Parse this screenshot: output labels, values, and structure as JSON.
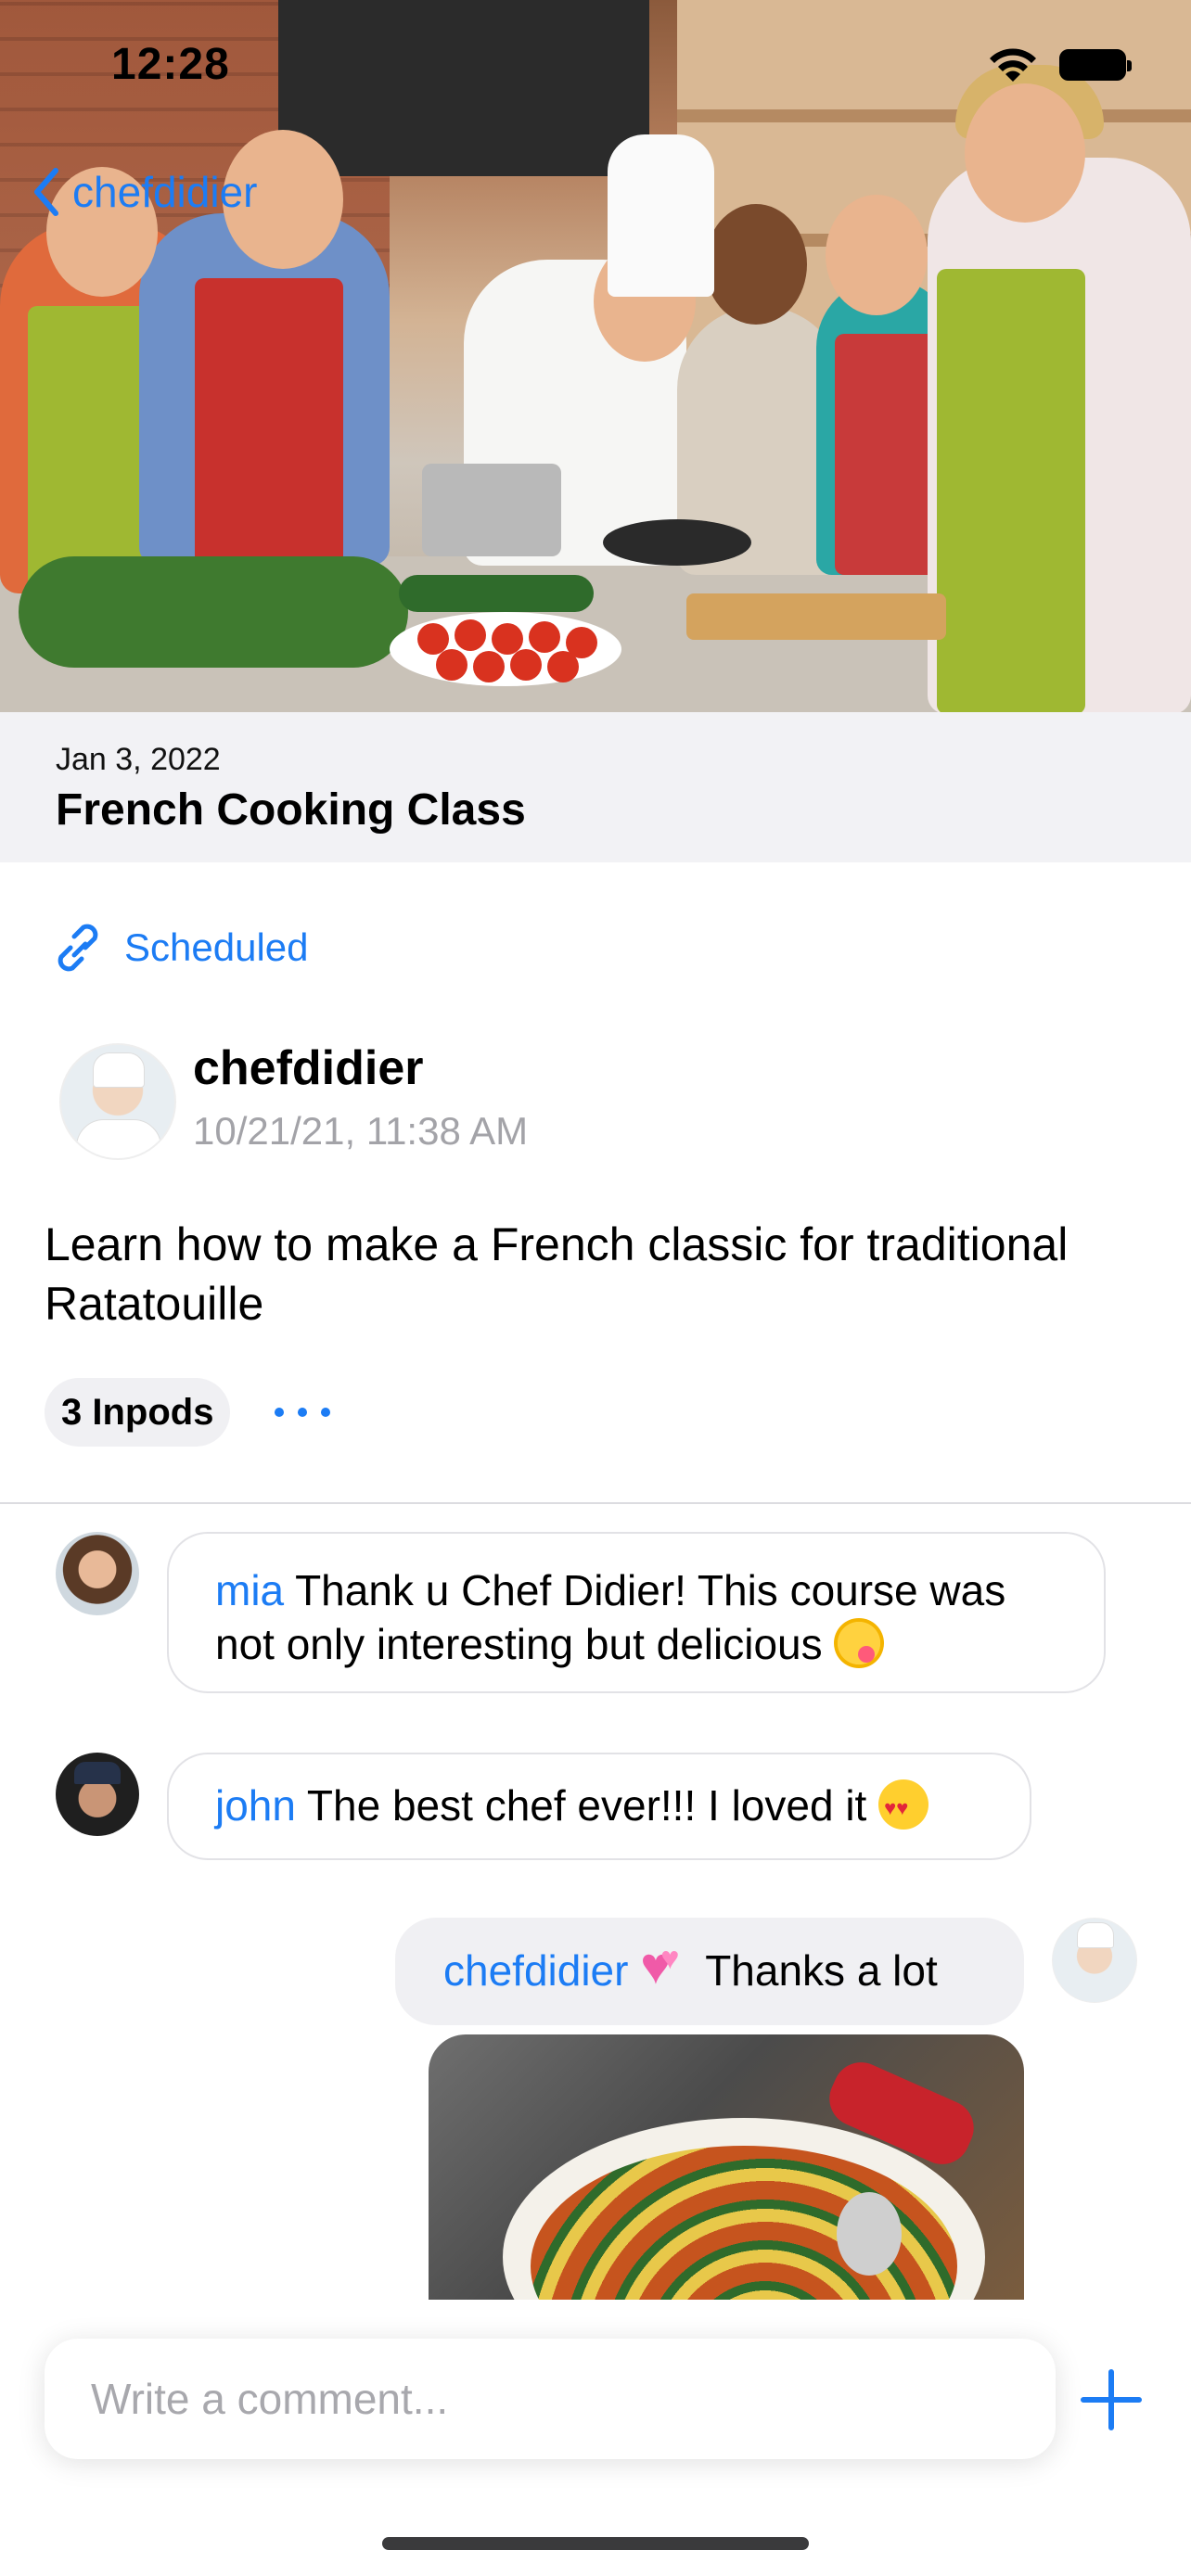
{
  "status_bar": {
    "time": "12:28"
  },
  "nav": {
    "back_label": "chefdidier"
  },
  "event": {
    "date": "Jan 3, 2022",
    "title": "French Cooking Class"
  },
  "scheduled_label": "Scheduled",
  "post": {
    "author": "chefdidier",
    "timestamp": "10/21/21, 11:38 AM",
    "description": "Learn how to make a French classic for traditional Ratatouille",
    "inpods_label": "3 Inpods"
  },
  "comments": [
    {
      "user": "mia",
      "text": "Thank u Chef Didier! This course was not only interesting but delicious"
    },
    {
      "user": "john",
      "text": "The best chef ever!!! I loved it"
    },
    {
      "user": "chefdidier",
      "text": "Thanks a lot"
    }
  ],
  "composer": {
    "placeholder": "Write a comment..."
  },
  "colors": {
    "accent": "#1c7cf4",
    "header_bg": "#f2f2f5",
    "muted_text": "#a3a3a8"
  }
}
